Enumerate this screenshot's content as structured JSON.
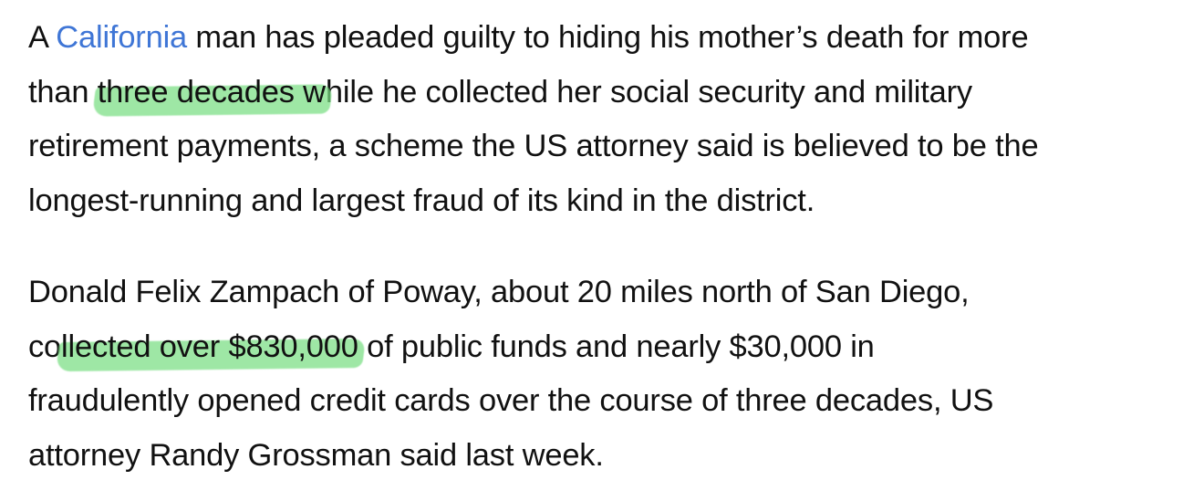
{
  "article": {
    "paragraph_1": {
      "line_1": {
        "before": "A ",
        "link": "California",
        "after": " man has pleaded guilty to hiding his mother’s death for more"
      },
      "line_2": {
        "before": "than ",
        "highlight": "three decades w",
        "after": "hile he collected her social security and military"
      },
      "line_3": "retirement payments, a scheme the US attorney said is believed to be the",
      "line_4": "longest-running and largest fraud of its kind in the district."
    },
    "paragraph_2": {
      "line_1": "Donald Felix Zampach of Poway, about 20 miles north of San Diego,",
      "line_2": {
        "before": "co",
        "highlight": "llected over $830,000",
        "after": " of public funds and nearly $30,000 in"
      },
      "line_3": "fraudulently opened credit cards over the course of three decades, US",
      "line_4": "attorney Randy Grossman said last week."
    }
  },
  "colors": {
    "text": "#111111",
    "link": "#3f76d6",
    "highlight": "#78de82",
    "background": "#ffffff"
  }
}
